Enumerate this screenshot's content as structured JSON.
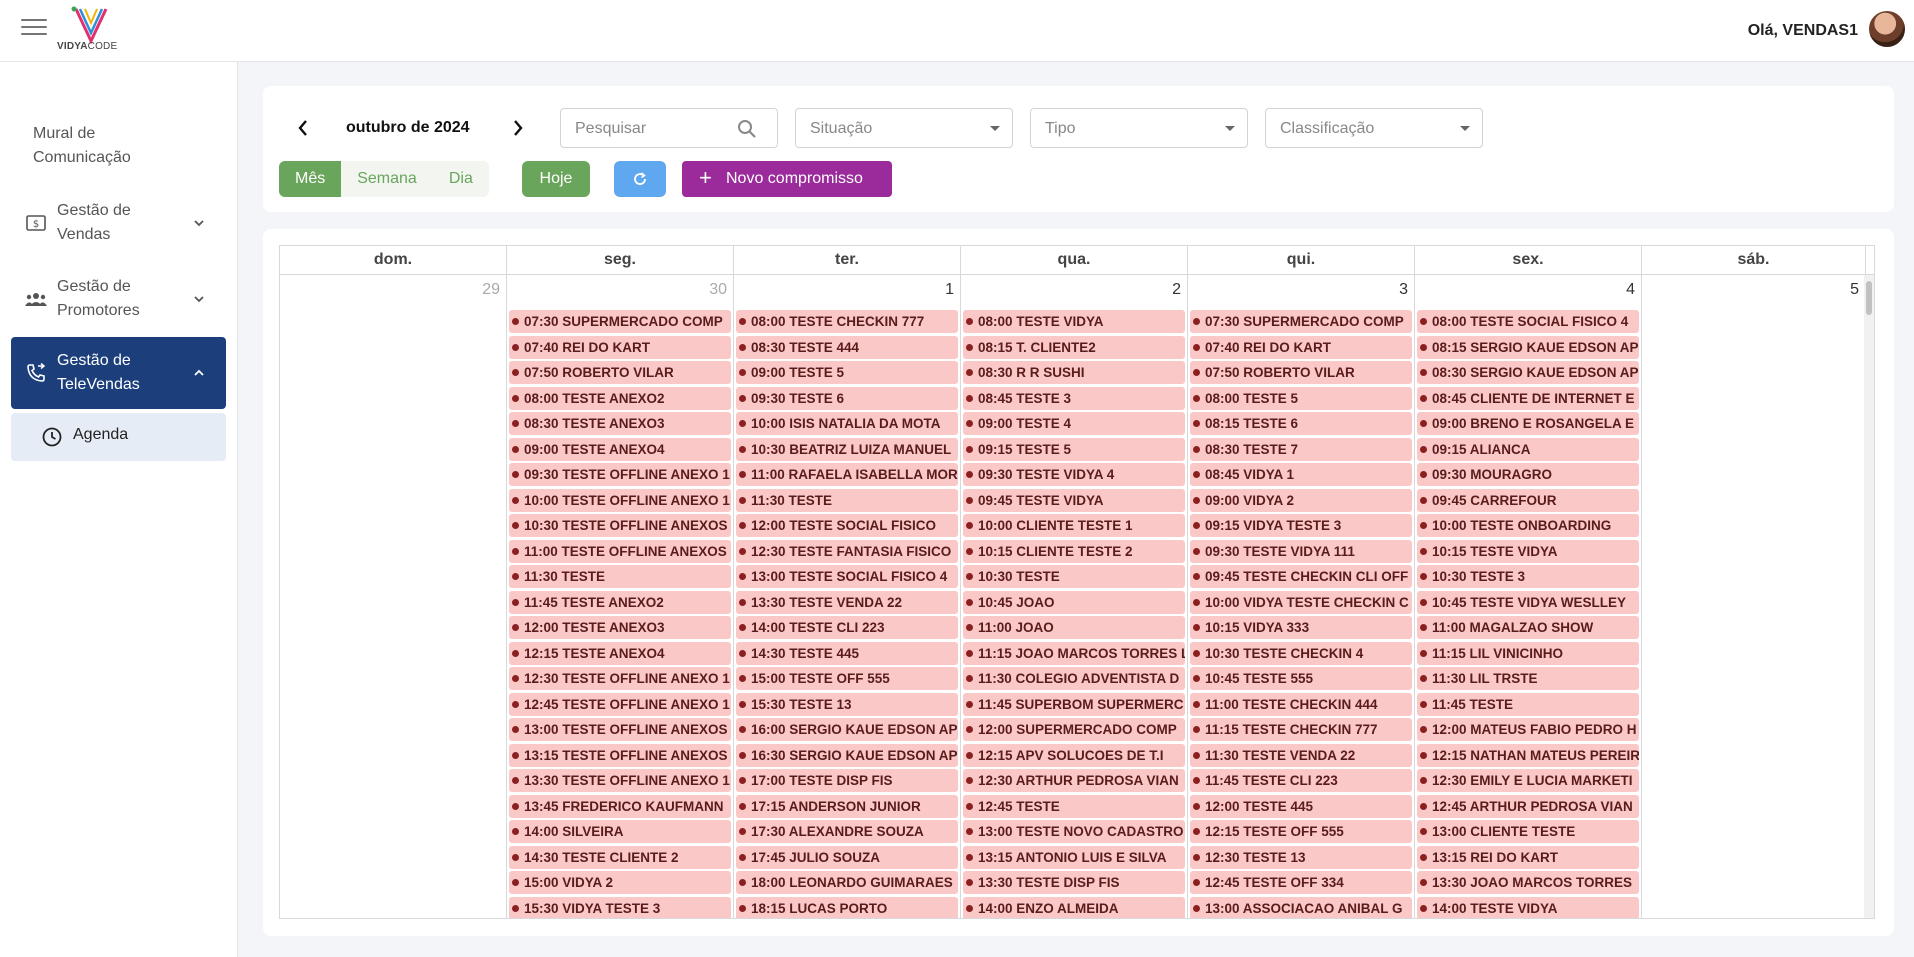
{
  "app": {
    "logo_bold": "VIDYA",
    "logo_light": "CODE",
    "greeting": "Olá, VENDAS1"
  },
  "sidebar": {
    "items": [
      {
        "label": "Mural de Comunicação"
      },
      {
        "label": "Gestão de Vendas"
      },
      {
        "label": "Gestão de Promotores"
      },
      {
        "label": "Gestão de TeleVendas"
      }
    ],
    "sub_items": [
      {
        "label": "Agenda"
      }
    ]
  },
  "toolbar": {
    "month": "outubro de 2024",
    "search_placeholder": "Pesquisar",
    "situacao_placeholder": "Situação",
    "tipo_placeholder": "Tipo",
    "classificacao_placeholder": "Classificação",
    "views": [
      "Mês",
      "Semana",
      "Dia"
    ],
    "active_view": "Mês",
    "today_label": "Hoje",
    "new_label": "Novo compromisso"
  },
  "calendar": {
    "weekdays": [
      "dom.",
      "seg.",
      "ter.",
      "qua.",
      "qui.",
      "sex.",
      "sáb."
    ],
    "days": [
      {
        "num": "29",
        "other_month": true,
        "events": []
      },
      {
        "num": "30",
        "other_month": true,
        "events": [
          "07:30 SUPERMERCADO COMP",
          "07:40 REI DO KART",
          "07:50 ROBERTO VILAR",
          "08:00 TESTE ANEXO2",
          "08:30 TESTE ANEXO3",
          "09:00 TESTE ANEXO4",
          "09:30 TESTE OFFLINE ANEXO 1",
          "10:00 TESTE OFFLINE ANEXO 1",
          "10:30 TESTE OFFLINE ANEXOS",
          "11:00 TESTE OFFLINE ANEXOS",
          "11:30 TESTE",
          "11:45 TESTE ANEXO2",
          "12:00 TESTE ANEXO3",
          "12:15 TESTE ANEXO4",
          "12:30 TESTE OFFLINE ANEXO 1",
          "12:45 TESTE OFFLINE ANEXO 1",
          "13:00 TESTE OFFLINE ANEXOS",
          "13:15 TESTE OFFLINE ANEXOS",
          "13:30 TESTE OFFLINE ANEXO 1",
          "13:45 FREDERICO KAUFMANN",
          "14:00 SILVEIRA",
          "14:30 TESTE CLIENTE 2",
          "15:00 VIDYA 2",
          "15:30 VIDYA TESTE 3"
        ]
      },
      {
        "num": "1",
        "other_month": false,
        "events": [
          "08:00 TESTE CHECKIN 777",
          "08:30 TESTE 444",
          "09:00 TESTE 5",
          "09:30 TESTE 6",
          "10:00 ISIS NATALIA DA MOTA",
          "10:30 BEATRIZ LUIZA MANUEL",
          "11:00 RAFAELA ISABELLA MOR",
          "11:30 TESTE",
          "12:00 TESTE SOCIAL FISICO",
          "12:30 TESTE FANTASIA FISICO",
          "13:00 TESTE SOCIAL FISICO 4",
          "13:30 TESTE VENDA 22",
          "14:00 TESTE CLI 223",
          "14:30 TESTE 445",
          "15:00 TESTE OFF 555",
          "15:30 TESTE 13",
          "16:00 SERGIO KAUE EDSON AP",
          "16:30 SERGIO KAUE EDSON AP",
          "17:00 TESTE DISP FIS",
          "17:15 ANDERSON JUNIOR",
          "17:30 ALEXANDRE SOUZA",
          "17:45 JULIO SOUZA",
          "18:00 LEONARDO GUIMARAES",
          "18:15 LUCAS PORTO"
        ]
      },
      {
        "num": "2",
        "other_month": false,
        "events": [
          "08:00 TESTE VIDYA",
          "08:15 T. CLIENTE2",
          "08:30 R R SUSHI",
          "08:45 TESTE 3",
          "09:00 TESTE 4",
          "09:15 TESTE 5",
          "09:30 TESTE VIDYA 4",
          "09:45 TESTE VIDYA",
          "10:00 CLIENTE TESTE 1",
          "10:15 CLIENTE TESTE 2",
          "10:30 TESTE",
          "10:45 JOAO",
          "11:00 JOAO",
          "11:15 JOAO MARCOS TORRES L",
          "11:30 COLEGIO ADVENTISTA D",
          "11:45 SUPERBOM SUPERMERC",
          "12:00 SUPERMERCADO COMP",
          "12:15 APV SOLUCOES DE T.I",
          "12:30 ARTHUR PEDROSA VIAN",
          "12:45 TESTE",
          "13:00 TESTE NOVO CADASTRO",
          "13:15 ANTONIO LUIS E SILVA",
          "13:30 TESTE DISP FIS",
          "14:00 ENZO ALMEIDA"
        ]
      },
      {
        "num": "3",
        "other_month": false,
        "events": [
          "07:30 SUPERMERCADO COMP",
          "07:40 REI DO KART",
          "07:50 ROBERTO VILAR",
          "08:00 TESTE 5",
          "08:15 TESTE 6",
          "08:30 TESTE 7",
          "08:45 VIDYA 1",
          "09:00 VIDYA 2",
          "09:15 VIDYA TESTE 3",
          "09:30 TESTE VIDYA 111",
          "09:45 TESTE CHECKIN CLI OFF",
          "10:00 VIDYA TESTE CHECKIN C",
          "10:15 VIDYA 333",
          "10:30 TESTE CHECKIN 4",
          "10:45 TESTE 555",
          "11:00 TESTE CHECKIN 444",
          "11:15 TESTE CHECKIN 777",
          "11:30 TESTE VENDA 22",
          "11:45 TESTE CLI 223",
          "12:00 TESTE 445",
          "12:15 TESTE OFF 555",
          "12:30 TESTE 13",
          "12:45 TESTE OFF 334",
          "13:00 ASSOCIACAO ANIBAL G"
        ]
      },
      {
        "num": "4",
        "other_month": false,
        "events": [
          "08:00 TESTE SOCIAL FISICO 4",
          "08:15 SERGIO KAUE EDSON AP",
          "08:30 SERGIO KAUE EDSON AP",
          "08:45 CLIENTE DE INTERNET E",
          "09:00 BRENO E ROSANGELA E",
          "09:15 ALIANCA",
          "09:30 MOURAGRO",
          "09:45 CARREFOUR",
          "10:00 TESTE ONBOARDING",
          "10:15 TESTE VIDYA",
          "10:30 TESTE 3",
          "10:45 TESTE VIDYA WESLLEY",
          "11:00 MAGALZAO SHOW",
          "11:15 LIL VINICINHO",
          "11:30 LIL TRSTE",
          "11:45 TESTE",
          "12:00 MATEUS FABIO PEDRO H",
          "12:15 NATHAN MATEUS PEREIR",
          "12:30 EMILY E LUCIA MARKETI",
          "12:45 ARTHUR PEDROSA VIAN",
          "13:00 CLIENTE TESTE",
          "13:15 REI DO KART",
          "13:30 JOAO MARCOS TORRES",
          "14:00 TESTE VIDYA"
        ]
      },
      {
        "num": "5",
        "other_month": false,
        "events": []
      }
    ]
  },
  "colors": {
    "primary_blue": "#1c3f7c",
    "green": "#69a55a",
    "purple": "#9b2b9b",
    "refresh_blue": "#5fa8ef",
    "event_bg": "#fbc8c8"
  }
}
